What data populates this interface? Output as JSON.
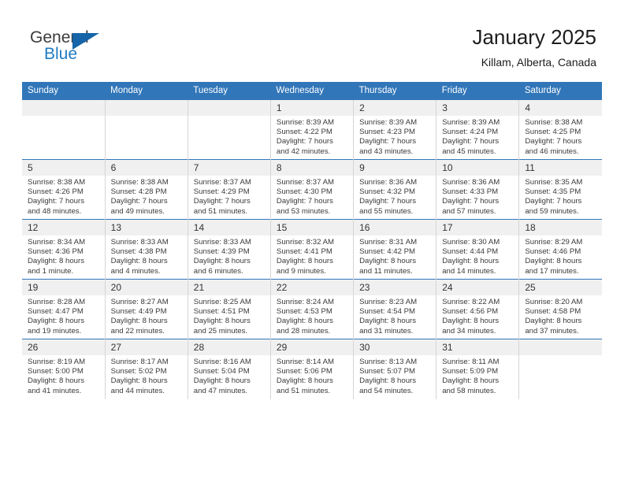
{
  "brand": {
    "name_top": "General",
    "name_bottom": "Blue",
    "accent_color": "#1565a8",
    "text_color": "#3b3b3b",
    "blue_text_color": "#1e7bc4"
  },
  "header": {
    "title": "January 2025",
    "subtitle": "Killam, Alberta, Canada"
  },
  "theme": {
    "header_bar_color": "#3176b9",
    "date_band_color": "#f0f0f0",
    "row_divider_color": "#3176b9",
    "column_divider_color": "#d5d5d5"
  },
  "weekday_headers": [
    "Sunday",
    "Monday",
    "Tuesday",
    "Wednesday",
    "Thursday",
    "Friday",
    "Saturday"
  ],
  "weeks": [
    [
      {
        "day": "",
        "empty": true,
        "lines": []
      },
      {
        "day": "",
        "empty": true,
        "lines": []
      },
      {
        "day": "",
        "empty": true,
        "lines": []
      },
      {
        "day": "1",
        "empty": false,
        "lines": [
          "Sunrise: 8:39 AM",
          "Sunset: 4:22 PM",
          "Daylight: 7 hours",
          "and 42 minutes."
        ]
      },
      {
        "day": "2",
        "empty": false,
        "lines": [
          "Sunrise: 8:39 AM",
          "Sunset: 4:23 PM",
          "Daylight: 7 hours",
          "and 43 minutes."
        ]
      },
      {
        "day": "3",
        "empty": false,
        "lines": [
          "Sunrise: 8:39 AM",
          "Sunset: 4:24 PM",
          "Daylight: 7 hours",
          "and 45 minutes."
        ]
      },
      {
        "day": "4",
        "empty": false,
        "lines": [
          "Sunrise: 8:38 AM",
          "Sunset: 4:25 PM",
          "Daylight: 7 hours",
          "and 46 minutes."
        ]
      }
    ],
    [
      {
        "day": "5",
        "empty": false,
        "lines": [
          "Sunrise: 8:38 AM",
          "Sunset: 4:26 PM",
          "Daylight: 7 hours",
          "and 48 minutes."
        ]
      },
      {
        "day": "6",
        "empty": false,
        "lines": [
          "Sunrise: 8:38 AM",
          "Sunset: 4:28 PM",
          "Daylight: 7 hours",
          "and 49 minutes."
        ]
      },
      {
        "day": "7",
        "empty": false,
        "lines": [
          "Sunrise: 8:37 AM",
          "Sunset: 4:29 PM",
          "Daylight: 7 hours",
          "and 51 minutes."
        ]
      },
      {
        "day": "8",
        "empty": false,
        "lines": [
          "Sunrise: 8:37 AM",
          "Sunset: 4:30 PM",
          "Daylight: 7 hours",
          "and 53 minutes."
        ]
      },
      {
        "day": "9",
        "empty": false,
        "lines": [
          "Sunrise: 8:36 AM",
          "Sunset: 4:32 PM",
          "Daylight: 7 hours",
          "and 55 minutes."
        ]
      },
      {
        "day": "10",
        "empty": false,
        "lines": [
          "Sunrise: 8:36 AM",
          "Sunset: 4:33 PM",
          "Daylight: 7 hours",
          "and 57 minutes."
        ]
      },
      {
        "day": "11",
        "empty": false,
        "lines": [
          "Sunrise: 8:35 AM",
          "Sunset: 4:35 PM",
          "Daylight: 7 hours",
          "and 59 minutes."
        ]
      }
    ],
    [
      {
        "day": "12",
        "empty": false,
        "lines": [
          "Sunrise: 8:34 AM",
          "Sunset: 4:36 PM",
          "Daylight: 8 hours",
          "and 1 minute."
        ]
      },
      {
        "day": "13",
        "empty": false,
        "lines": [
          "Sunrise: 8:33 AM",
          "Sunset: 4:38 PM",
          "Daylight: 8 hours",
          "and 4 minutes."
        ]
      },
      {
        "day": "14",
        "empty": false,
        "lines": [
          "Sunrise: 8:33 AM",
          "Sunset: 4:39 PM",
          "Daylight: 8 hours",
          "and 6 minutes."
        ]
      },
      {
        "day": "15",
        "empty": false,
        "lines": [
          "Sunrise: 8:32 AM",
          "Sunset: 4:41 PM",
          "Daylight: 8 hours",
          "and 9 minutes."
        ]
      },
      {
        "day": "16",
        "empty": false,
        "lines": [
          "Sunrise: 8:31 AM",
          "Sunset: 4:42 PM",
          "Daylight: 8 hours",
          "and 11 minutes."
        ]
      },
      {
        "day": "17",
        "empty": false,
        "lines": [
          "Sunrise: 8:30 AM",
          "Sunset: 4:44 PM",
          "Daylight: 8 hours",
          "and 14 minutes."
        ]
      },
      {
        "day": "18",
        "empty": false,
        "lines": [
          "Sunrise: 8:29 AM",
          "Sunset: 4:46 PM",
          "Daylight: 8 hours",
          "and 17 minutes."
        ]
      }
    ],
    [
      {
        "day": "19",
        "empty": false,
        "lines": [
          "Sunrise: 8:28 AM",
          "Sunset: 4:47 PM",
          "Daylight: 8 hours",
          "and 19 minutes."
        ]
      },
      {
        "day": "20",
        "empty": false,
        "lines": [
          "Sunrise: 8:27 AM",
          "Sunset: 4:49 PM",
          "Daylight: 8 hours",
          "and 22 minutes."
        ]
      },
      {
        "day": "21",
        "empty": false,
        "lines": [
          "Sunrise: 8:25 AM",
          "Sunset: 4:51 PM",
          "Daylight: 8 hours",
          "and 25 minutes."
        ]
      },
      {
        "day": "22",
        "empty": false,
        "lines": [
          "Sunrise: 8:24 AM",
          "Sunset: 4:53 PM",
          "Daylight: 8 hours",
          "and 28 minutes."
        ]
      },
      {
        "day": "23",
        "empty": false,
        "lines": [
          "Sunrise: 8:23 AM",
          "Sunset: 4:54 PM",
          "Daylight: 8 hours",
          "and 31 minutes."
        ]
      },
      {
        "day": "24",
        "empty": false,
        "lines": [
          "Sunrise: 8:22 AM",
          "Sunset: 4:56 PM",
          "Daylight: 8 hours",
          "and 34 minutes."
        ]
      },
      {
        "day": "25",
        "empty": false,
        "lines": [
          "Sunrise: 8:20 AM",
          "Sunset: 4:58 PM",
          "Daylight: 8 hours",
          "and 37 minutes."
        ]
      }
    ],
    [
      {
        "day": "26",
        "empty": false,
        "lines": [
          "Sunrise: 8:19 AM",
          "Sunset: 5:00 PM",
          "Daylight: 8 hours",
          "and 41 minutes."
        ]
      },
      {
        "day": "27",
        "empty": false,
        "lines": [
          "Sunrise: 8:17 AM",
          "Sunset: 5:02 PM",
          "Daylight: 8 hours",
          "and 44 minutes."
        ]
      },
      {
        "day": "28",
        "empty": false,
        "lines": [
          "Sunrise: 8:16 AM",
          "Sunset: 5:04 PM",
          "Daylight: 8 hours",
          "and 47 minutes."
        ]
      },
      {
        "day": "29",
        "empty": false,
        "lines": [
          "Sunrise: 8:14 AM",
          "Sunset: 5:06 PM",
          "Daylight: 8 hours",
          "and 51 minutes."
        ]
      },
      {
        "day": "30",
        "empty": false,
        "lines": [
          "Sunrise: 8:13 AM",
          "Sunset: 5:07 PM",
          "Daylight: 8 hours",
          "and 54 minutes."
        ]
      },
      {
        "day": "31",
        "empty": false,
        "lines": [
          "Sunrise: 8:11 AM",
          "Sunset: 5:09 PM",
          "Daylight: 8 hours",
          "and 58 minutes."
        ]
      },
      {
        "day": "",
        "empty": true,
        "lines": []
      }
    ]
  ]
}
